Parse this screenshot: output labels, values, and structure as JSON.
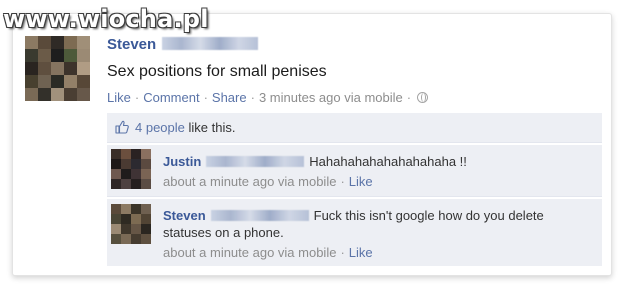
{
  "watermark": "www.wiocha.pl",
  "post": {
    "author": "Steven",
    "text": "Sex positions for small penises",
    "actions": {
      "like": "Like",
      "comment": "Comment",
      "share": "Share",
      "separator": "·"
    },
    "timestamp": "3 minutes ago via mobile",
    "privacy_icon": "globe-icon"
  },
  "likes": {
    "count_link": "4 people",
    "suffix": " like this.",
    "icon": "thumbs-up-icon"
  },
  "comments": [
    {
      "author": "Justin",
      "text": "Hahahahahahahahahaha !!",
      "timestamp": "about a minute ago via mobile",
      "like": "Like"
    },
    {
      "author": "Steven",
      "text": "Fuck this isn't google how do you delete statuses on a phone.",
      "timestamp": "about a minute ago via mobile",
      "like": "Like"
    }
  ],
  "colors": {
    "link": "#3b5998",
    "meta": "#8d8d8d",
    "comment_bg": "#edeff4"
  }
}
